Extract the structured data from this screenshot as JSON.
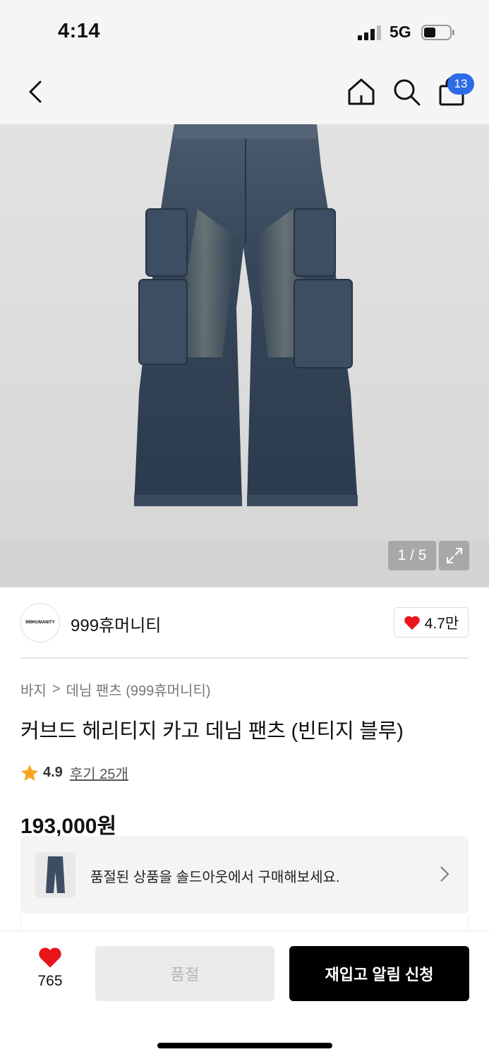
{
  "status_bar": {
    "time": "4:14",
    "network": "5G"
  },
  "header": {
    "cart_count": "13"
  },
  "gallery": {
    "pager": "1 / 5"
  },
  "brand": {
    "logo_text": "999HUMANITY",
    "name": "999휴머니티",
    "likes": "4.7만"
  },
  "breadcrumb": {
    "category": "바지",
    "separator": ">",
    "subcategory": "데님 팬츠 (999휴머니티)"
  },
  "product": {
    "title": "커브드 헤리티지 카고 데님 팬츠 (빈티지 블루)",
    "rating": "4.9",
    "reviews": "후기 25개",
    "price": "193,000원"
  },
  "soldout_banner": {
    "text": "품절된 상품을 솔드아웃에서 구매해보세요."
  },
  "bottom_bar": {
    "like_count": "765",
    "soldout_label": "품절",
    "restock_label": "재입고 알림 신청"
  },
  "colors": {
    "accent_blue": "#2e6be6",
    "heart_red": "#e8151b",
    "star_orange": "#f5a623",
    "primary_black": "#000000"
  }
}
